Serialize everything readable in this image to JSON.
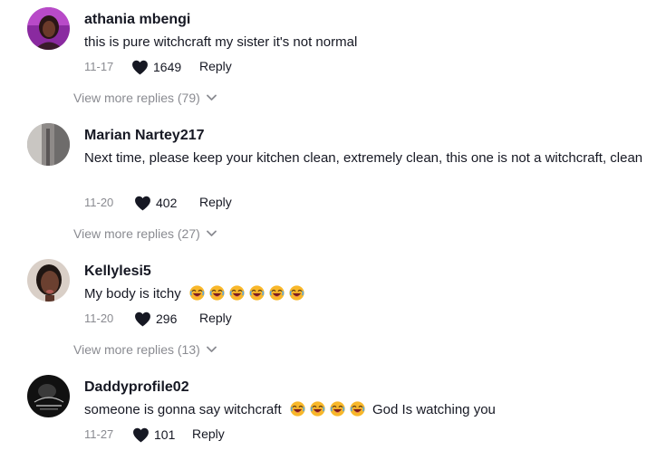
{
  "comments": [
    {
      "username": "athania mbengi",
      "text": "this is pure witchcraft my sister it's not normal",
      "date": "11-17",
      "likes": "1649",
      "reply_label": "Reply",
      "view_more": "View more replies (79)",
      "avatar_icon": "profile-photo"
    },
    {
      "username": "Marian Nartey217",
      "text": "Next time, please keep your kitchen clean, extremely clean, this one is not a witchcraft, clean",
      "date": "11-20",
      "likes": "402",
      "reply_label": "Reply",
      "view_more": "View more replies (27)",
      "avatar_icon": "profile-photo"
    },
    {
      "username": "Kellylesi5",
      "text": "My body is itchy",
      "text_emojis": [
        "laughing-crying-emoji",
        "laughing-crying-emoji",
        "laughing-crying-emoji",
        "laughing-crying-emoji",
        "laughing-crying-emoji",
        "laughing-crying-emoji"
      ],
      "date": "11-20",
      "likes": "296",
      "reply_label": "Reply",
      "view_more": "View more replies (13)",
      "avatar_icon": "profile-photo"
    },
    {
      "username": "Daddyprofile02",
      "text": "someone is gonna say witchcraft",
      "text_emojis": [
        "laughing-emoji",
        "laughing-emoji",
        "laughing-emoji",
        "laughing-emoji"
      ],
      "text_after": "God Is watching you",
      "date": "11-27",
      "likes": "101",
      "reply_label": "Reply",
      "avatar_icon": "profile-photo"
    }
  ],
  "colors": {
    "text_primary": "#161823",
    "text_secondary": "#8a8b91",
    "heart": "#161823",
    "emoji_face": "#f8b72a"
  }
}
